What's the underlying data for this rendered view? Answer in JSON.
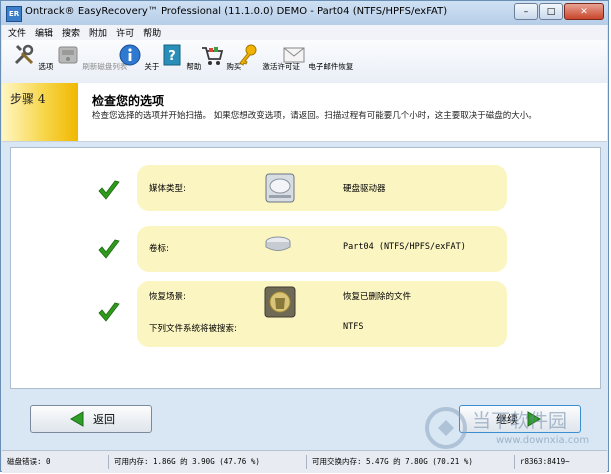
{
  "window": {
    "title": "Ontrack® EasyRecovery™ Professional (11.1.0.0) DEMO - Part04 (NTFS/HPFS/exFAT)",
    "app_icon_text": "ER",
    "minimize": "–",
    "maximize": "□",
    "close": "✕"
  },
  "menu": [
    "文件",
    "编辑",
    "搜索",
    "附加",
    "许可",
    "帮助"
  ],
  "toolbar": {
    "options": "选项",
    "unmount": "刷新磁盘列表",
    "about": "关于",
    "help": "帮助",
    "buy": "购买",
    "activate": "激活许可证",
    "email": "电子邮件恢复"
  },
  "step": {
    "label": "步骤 4",
    "title": "检查您的选项",
    "description": "检查您选择的选项并开始扫描。 如果您想改变选项，请返回。扫描过程有可能要几个小时，这主要取决于磁盘的大小。"
  },
  "cards": {
    "media_label": "媒体类型:",
    "media_value": "硬盘驱动器",
    "volume_label": "卷标:",
    "volume_value": "Part04 (NTFS/HPFS/exFAT)",
    "scenario_label": "恢复场景:",
    "scenario_value": "恢复已删除的文件",
    "fs_label": "下列文件系统将被搜索:",
    "fs_value": "NTFS"
  },
  "buttons": {
    "back": "返回",
    "continue": "继续"
  },
  "status": {
    "disk_errors": "磁盘错误: 0",
    "memory": "可用内存: 1.86G 的 3.90G (47.76 %)",
    "swap": "可用交换内存: 5.47G 的 7.80G (70.21 %)",
    "build": "r8363:8419~"
  },
  "watermark": {
    "brand": "当下软件园",
    "url": "www.downxia.com"
  },
  "colors": {
    "card_bg": "#fbf5c2",
    "step_accent": "#f0b800",
    "check_green": "#2f9a1c",
    "arrow_green": "#2f9e27"
  }
}
